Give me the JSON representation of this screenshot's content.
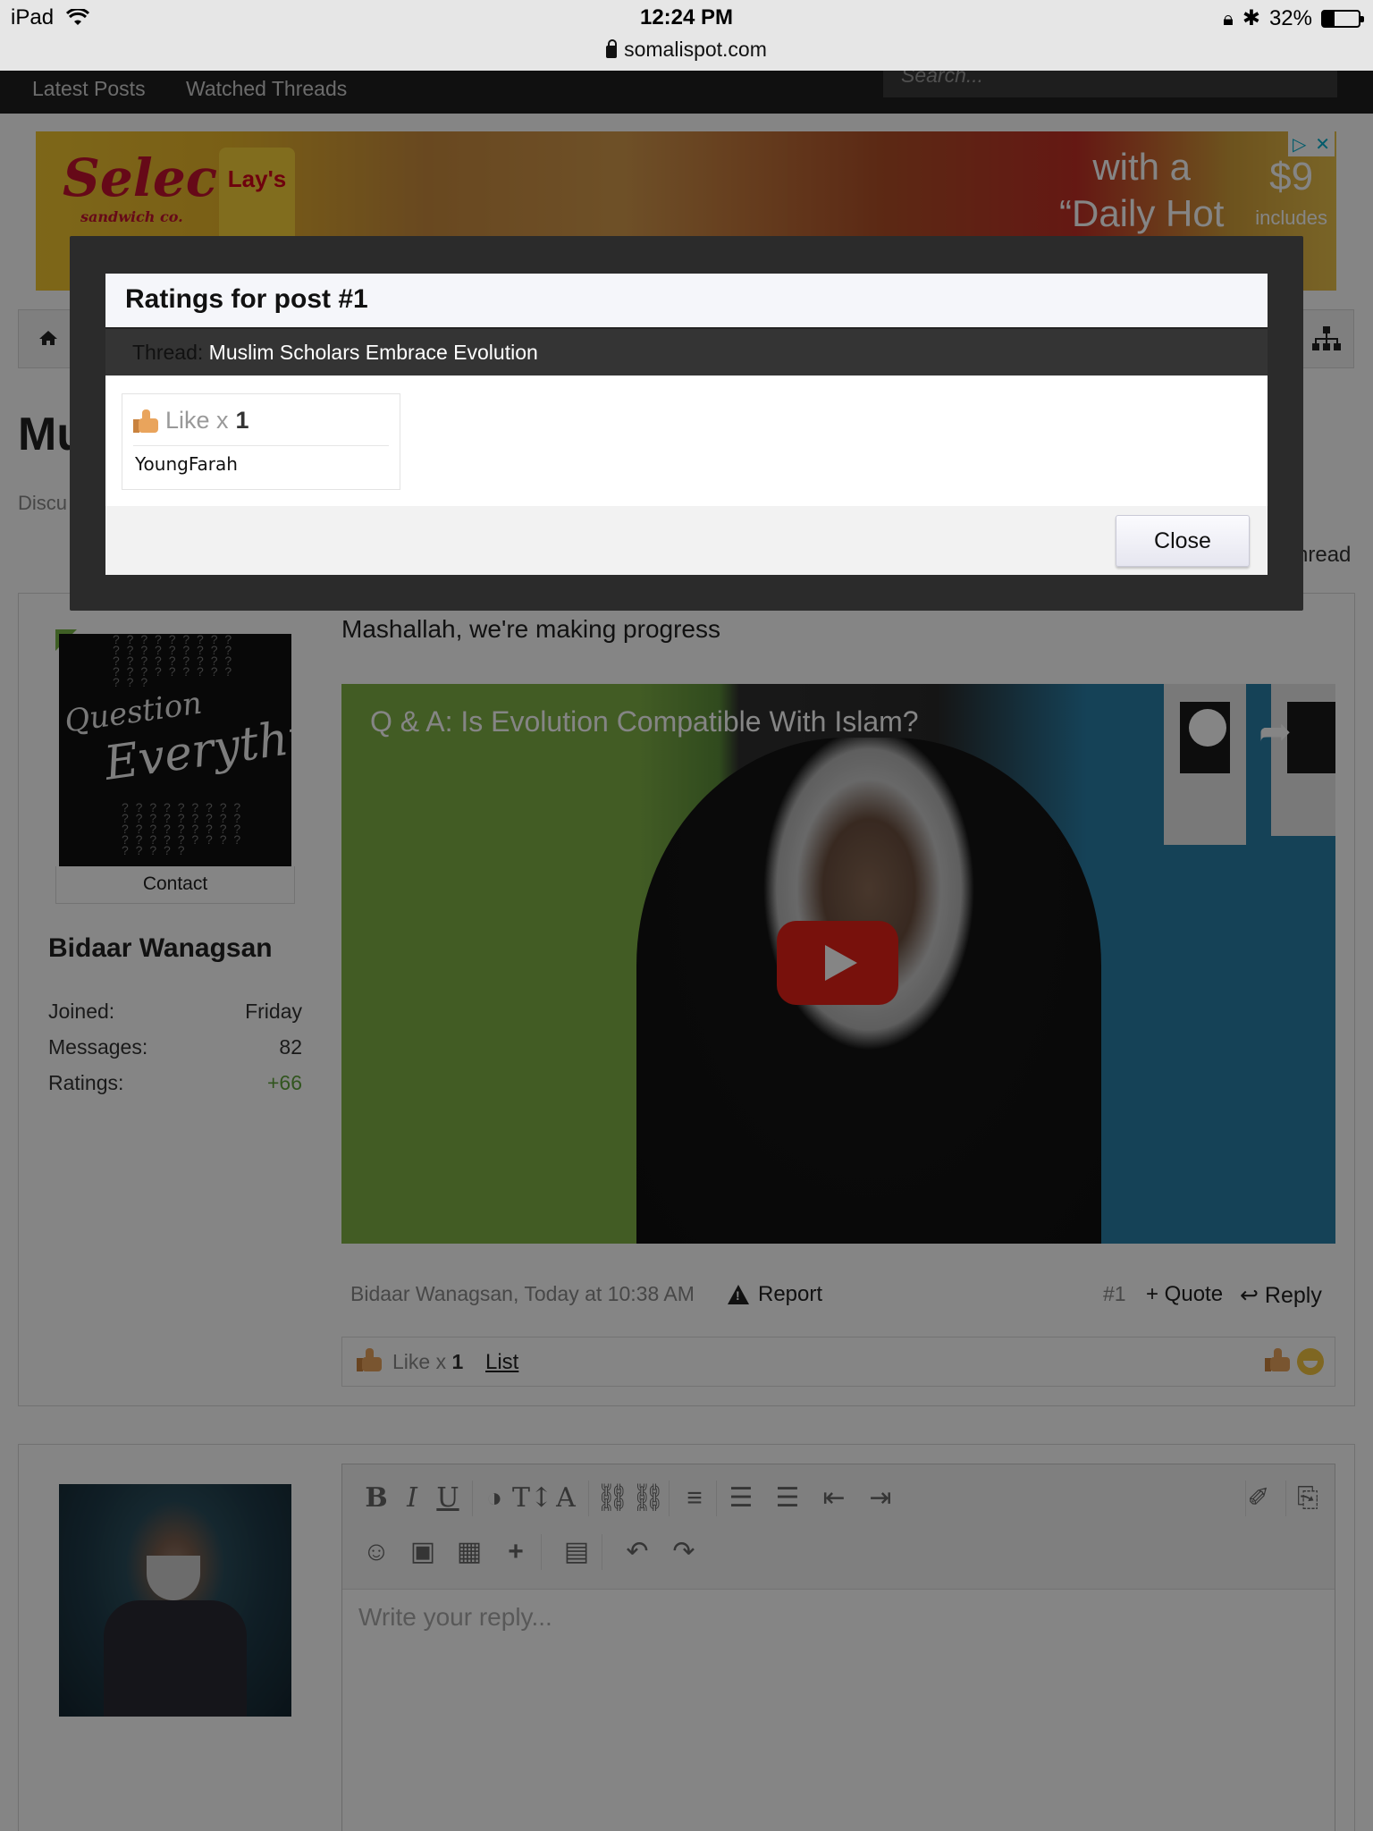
{
  "status_bar": {
    "device": "iPad",
    "time": "12:24 PM",
    "battery": "32%",
    "battery_level": 0.32,
    "url": "somalispot.com"
  },
  "nav": {
    "links": [
      "Latest Posts",
      "Watched Threads"
    ],
    "search_placeholder": "Search..."
  },
  "ad": {
    "brand": "Select",
    "brand_sub": "sandwich co.",
    "chips": "Lay's",
    "copy_line1": "with a",
    "copy_line2": "“Daily Hot",
    "price": "$9",
    "price_note": "includes"
  },
  "page": {
    "title_partial": "Mu",
    "breadcrumb_partial": "Discu",
    "thread_tool_partial": "hread"
  },
  "post": {
    "message": "Mashallah, we're making progress",
    "video_title": "Q & A: Is Evolution Compatible With Islam?",
    "author": "Bidaar Wanagsan",
    "meta": "Bidaar Wanagsan, Today at 10:38 AM",
    "report": "Report",
    "number": "#1",
    "quote": "+ Quote",
    "reply": "Reply",
    "like_label": "Like x",
    "like_count": "1",
    "list_link": "List",
    "contact": "Contact",
    "avatar_text_1": "Question",
    "avatar_text_2": "Everything",
    "stats": [
      {
        "label": "Joined:",
        "value": "Friday"
      },
      {
        "label": "Messages:",
        "value": "82"
      },
      {
        "label": "Ratings:",
        "value": "+66"
      }
    ]
  },
  "editor": {
    "placeholder": "Write your reply...",
    "toolbar_row1": [
      "B",
      "I",
      "U",
      "◑",
      "T↕",
      "A",
      "⛓",
      "⛓",
      "≡",
      "☰",
      "☰",
      "⇤",
      "⇥",
      "✐",
      "⎘"
    ],
    "toolbar_row2": [
      "☺",
      "▣",
      "▦",
      "+",
      "▤",
      "↶",
      "↷"
    ]
  },
  "modal": {
    "title": "Ratings for post #1",
    "thread_label": "Thread:",
    "thread_value": "Muslim Scholars Embrace Evolution",
    "rating_label": "Like x",
    "rating_count": "1",
    "rater": "YoungFarah",
    "close": "Close"
  },
  "colors": {
    "accent_green": "#5fa33b",
    "modal_frame": "#2b2b2b",
    "play_red": "#e62117"
  }
}
